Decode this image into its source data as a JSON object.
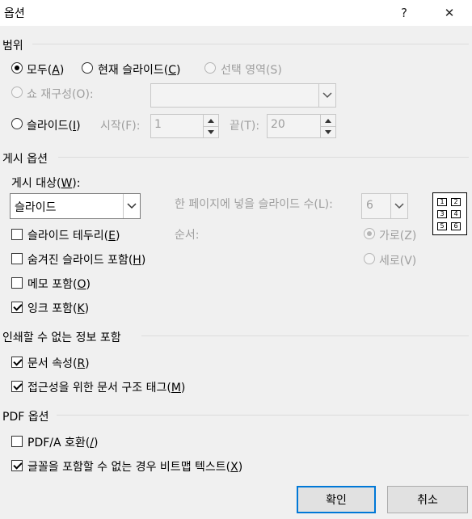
{
  "title": "옵션",
  "help_glyph": "?",
  "close_glyph": "✕",
  "range": {
    "section": "범위",
    "all_label": "모두(",
    "all_key": "A",
    "all_end": ")",
    "current_label": "현재 슬라이드(",
    "current_key": "C",
    "current_end": ")",
    "selection_label": "선택 영역(S)",
    "custom_show_label": "쇼 재구성(O):",
    "custom_show_value": "",
    "slides_label": "슬라이드(",
    "slides_key": "I",
    "slides_end": ")",
    "from_label": "시작(F):",
    "from_value": "1",
    "to_label": "끝(T):",
    "to_value": "20"
  },
  "publish": {
    "section": "게시 옵션",
    "what_label_a": "게시 대상(",
    "what_key": "W",
    "what_label_b": "):",
    "what_value": "슬라이드",
    "per_page_label": "한 페이지에 넣을 슬라이드 수(L):",
    "per_page_value": "6",
    "order_label": "순서:",
    "horizontal_label": "가로(Z)",
    "vertical_label": "세로(V)",
    "frame_label": "슬라이드 테두리(",
    "frame_key": "E",
    "frame_end": ")",
    "hidden_label": "숨겨진 슬라이드 포함(",
    "hidden_key": "H",
    "hidden_end": ")",
    "comments_label": "메모 포함(",
    "comments_key": "O",
    "comments_end": ")",
    "ink_label": "잉크 포함(",
    "ink_key": "K",
    "ink_end": ")",
    "layout_nums": [
      "1",
      "2",
      "3",
      "4",
      "5",
      "6"
    ]
  },
  "nonprint": {
    "section": "인쇄할 수 없는 정보 포함",
    "docprops_label": "문서 속성(",
    "docprops_key": "R",
    "docprops_end": ")",
    "tags_label": "접근성을 위한 문서 구조 태그(",
    "tags_key": "M",
    "tags_end": ")"
  },
  "pdf": {
    "section": "PDF 옵션",
    "pdfa_label": "PDF/A 호환(",
    "pdfa_key": "/",
    "pdfa_end": ")",
    "bitmap_label": "글꼴을 포함할 수 없는 경우 비트맵 텍스트(",
    "bitmap_key": "X",
    "bitmap_end": ")"
  },
  "buttons": {
    "ok": "확인",
    "cancel": "취소"
  }
}
